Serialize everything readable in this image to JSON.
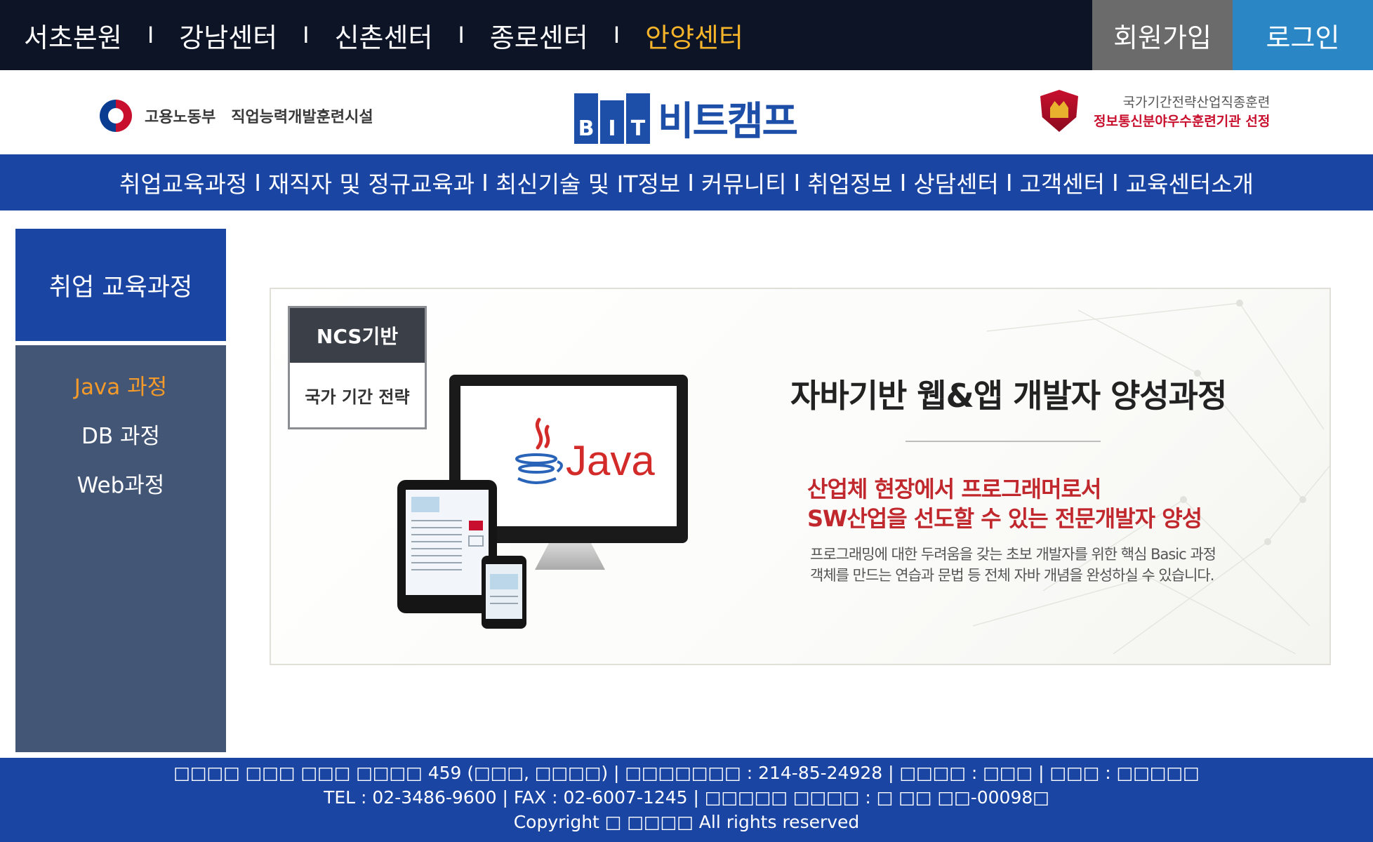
{
  "top_bar": {
    "centers": [
      "서초본원",
      "강남센터",
      "신촌센터",
      "종로센터",
      "안양센터"
    ],
    "separator": "I",
    "active_center": "안양센터",
    "join_label": "회원가입",
    "login_label": "로그인",
    "colors": {
      "background": "#0d1426",
      "active": "#f6b42a",
      "join_bg": "#6b6b6b",
      "login_bg": "#2a86c4"
    }
  },
  "logo_row": {
    "moel_ministry": "고용노동부",
    "moel_facility": "직업능력개발훈련시설",
    "bit_letters": [
      "B",
      "I",
      "T"
    ],
    "bit_name": "비트캠프",
    "award_line1": "국가기간전략산업직종훈련",
    "award_line2": "정보통신분야우수훈련기관 선정"
  },
  "nav": {
    "items": [
      "취업교육과정",
      "재직자 및 정규교육과",
      "최신기술 및 IT정보",
      "커뮤니티",
      "취업정보",
      "상담센터",
      "고객센터",
      "교육센터소개"
    ],
    "separator": "I",
    "colors": {
      "background": "#1b45a3"
    }
  },
  "sidebar": {
    "title": "취업 교육과정",
    "items": [
      "Java 과정",
      "DB 과정",
      "Web과정"
    ],
    "active_item": "Java 과정",
    "colors": {
      "head_bg": "#1b45a3",
      "menu_bg": "#435676",
      "active": "#f39a2a"
    }
  },
  "banner": {
    "ncs_top": "NCS기반",
    "ncs_bottom": "국가 기간 전략",
    "java_text": "Java",
    "title": "자바기반 웹&앱 개발자 양성과정",
    "subtitle_line1": "산업체 현장에서 프로그래머로서",
    "subtitle_line2": "SW산업을 선도할 수 있는 전문개발자 양성",
    "desc_line1": "프로그래밍에 대한 두려움을 갖는 초보 개발자를 위한 핵심 Basic 과정",
    "desc_line2": "객체를 만드는 연습과 문법 등 전체 자바 개념을 완성하실 수 있습니다.",
    "icons": [
      "monitor-icon",
      "tablet-icon",
      "phone-icon",
      "java-cup-icon"
    ]
  },
  "footer": {
    "line1": "□□□□ □□□ □□□ □□□□ 459 (□□□, □□□□) | □□□□□□□ : 214-85-24928 | □□□□ : □□□ | □□□ : □□□□□",
    "line2": "TEL : 02-3486-9600 | FAX : 02-6007-1245 | □□□□□ □□□□ : □ □□ □□-00098□",
    "line3": "Copyright □ □□□□ All rights reserved"
  }
}
